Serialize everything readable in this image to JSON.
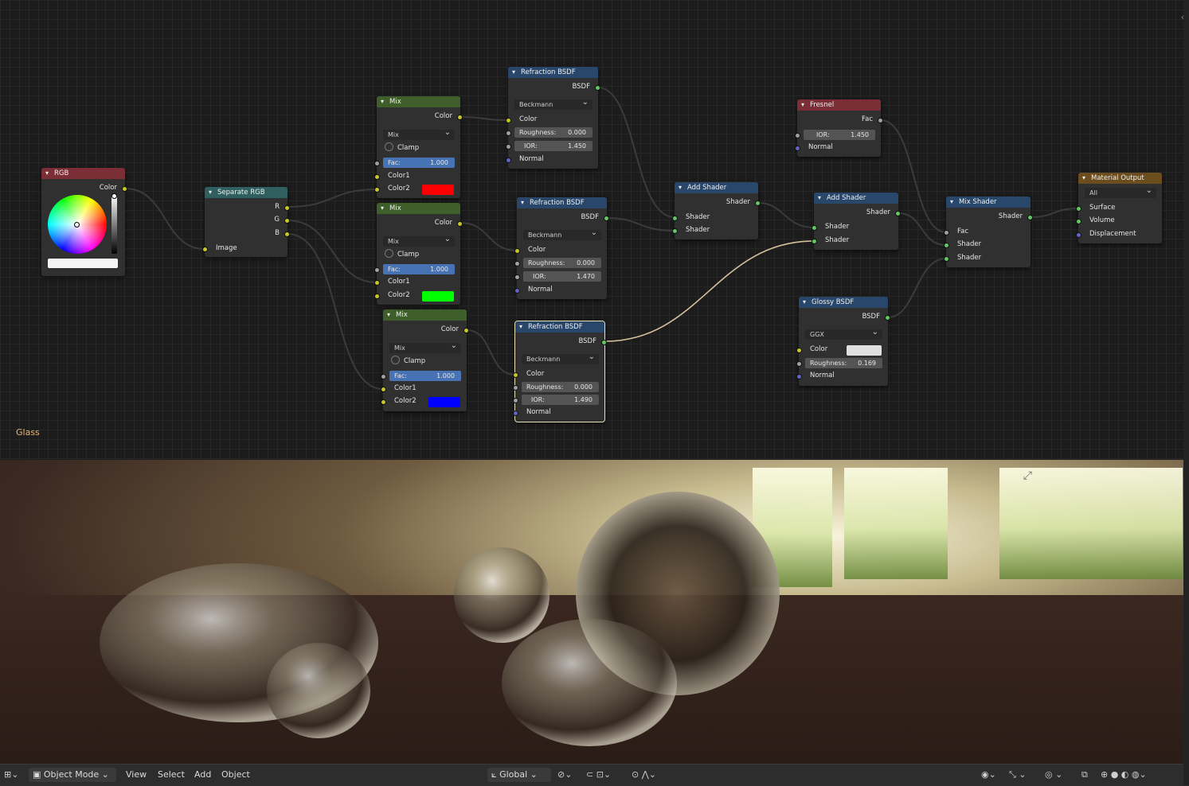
{
  "material_name": "Glass",
  "colors": {
    "red_swatch": "#ff0000",
    "green_swatch": "#00ff00",
    "blue_swatch": "#0000ff",
    "glossy_color": "#e0e0e0",
    "selection": "#e8e1b3"
  },
  "nodes": {
    "rgb": {
      "title": "RGB",
      "output": "Color"
    },
    "separate": {
      "title": "Separate RGB",
      "out_r": "R",
      "out_g": "G",
      "out_b": "B",
      "input": "Image"
    },
    "mix1": {
      "title": "Mix",
      "output": "Color",
      "blend": "Mix",
      "clamp": "Clamp",
      "fac_label": "Fac:",
      "fac_value": "1.000",
      "color1": "Color1",
      "color2": "Color2"
    },
    "mix2": {
      "title": "Mix",
      "output": "Color",
      "blend": "Mix",
      "clamp": "Clamp",
      "fac_label": "Fac:",
      "fac_value": "1.000",
      "color1": "Color1",
      "color2": "Color2"
    },
    "mix3": {
      "title": "Mix",
      "output": "Color",
      "blend": "Mix",
      "clamp": "Clamp",
      "fac_label": "Fac:",
      "fac_value": "1.000",
      "color1": "Color1",
      "color2": "Color2"
    },
    "refr1": {
      "title": "Refraction BSDF",
      "output": "BSDF",
      "distribution": "Beckmann",
      "color": "Color",
      "rough_label": "Roughness:",
      "rough_value": "0.000",
      "ior_label": "IOR:",
      "ior_value": "1.450",
      "normal": "Normal"
    },
    "refr2": {
      "title": "Refraction BSDF",
      "output": "BSDF",
      "distribution": "Beckmann",
      "color": "Color",
      "rough_label": "Roughness:",
      "rough_value": "0.000",
      "ior_label": "IOR:",
      "ior_value": "1.470",
      "normal": "Normal"
    },
    "refr3": {
      "title": "Refraction BSDF",
      "output": "BSDF",
      "distribution": "Beckmann",
      "color": "Color",
      "rough_label": "Roughness:",
      "rough_value": "0.000",
      "ior_label": "IOR:",
      "ior_value": "1.490",
      "normal": "Normal"
    },
    "fresnel": {
      "title": "Fresnel",
      "output": "Fac",
      "ior_label": "IOR:",
      "ior_value": "1.450",
      "normal": "Normal"
    },
    "add1": {
      "title": "Add Shader",
      "output": "Shader",
      "in1": "Shader",
      "in2": "Shader"
    },
    "add2": {
      "title": "Add Shader",
      "output": "Shader",
      "in1": "Shader",
      "in2": "Shader"
    },
    "glossy": {
      "title": "Glossy BSDF",
      "output": "BSDF",
      "distribution": "GGX",
      "color": "Color",
      "rough_label": "Roughness:",
      "rough_value": "0.169",
      "normal": "Normal"
    },
    "mixshader": {
      "title": "Mix Shader",
      "output": "Shader",
      "fac": "Fac",
      "in1": "Shader",
      "in2": "Shader"
    },
    "output": {
      "title": "Material Output",
      "target": "All",
      "surface": "Surface",
      "volume": "Volume",
      "displacement": "Displacement"
    }
  },
  "header": {
    "mode": "Object Mode",
    "menus": [
      "View",
      "Select",
      "Add",
      "Object"
    ],
    "transform_orientation": "Global"
  },
  "icons": {
    "editor_type": "editor-type-icon",
    "mode": "object-mode-icon",
    "orientation": "transform-orientation-icon",
    "pivot": "pivot-icon",
    "snap": "snap-icon",
    "proportional": "proportional-edit-icon",
    "visibility": "visibility-icon",
    "gizmo": "gizmo-icon",
    "overlay": "overlay-icon",
    "xray": "xray-icon",
    "shading": "shading-mode-icons"
  }
}
